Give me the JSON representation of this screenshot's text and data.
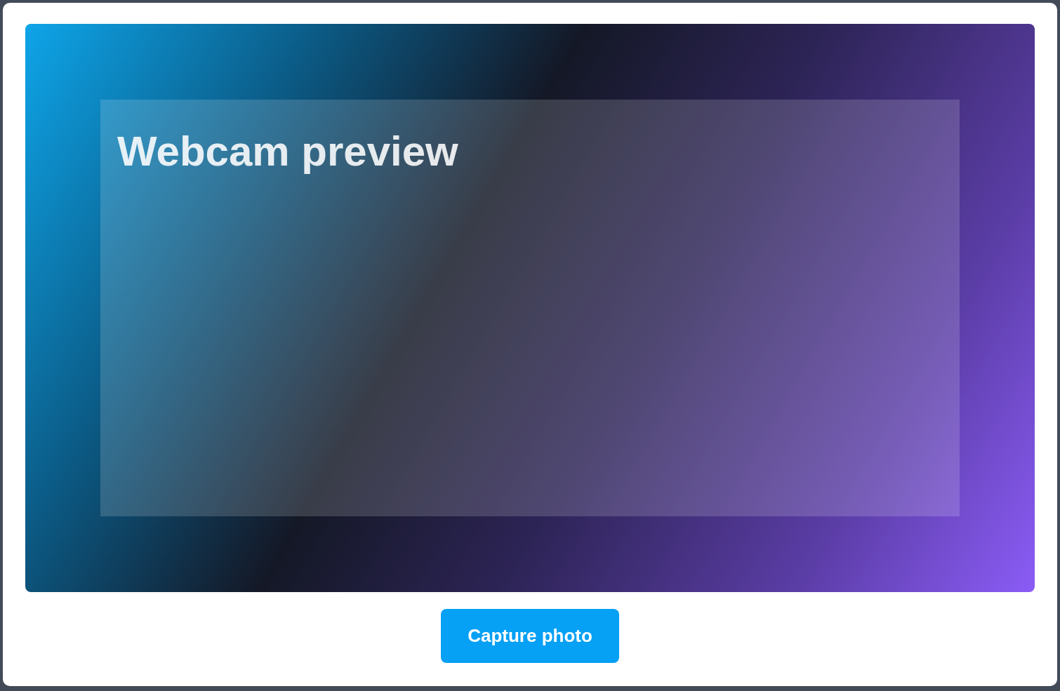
{
  "preview": {
    "label": "Webcam preview"
  },
  "capture_button": {
    "label": "Capture photo"
  }
}
